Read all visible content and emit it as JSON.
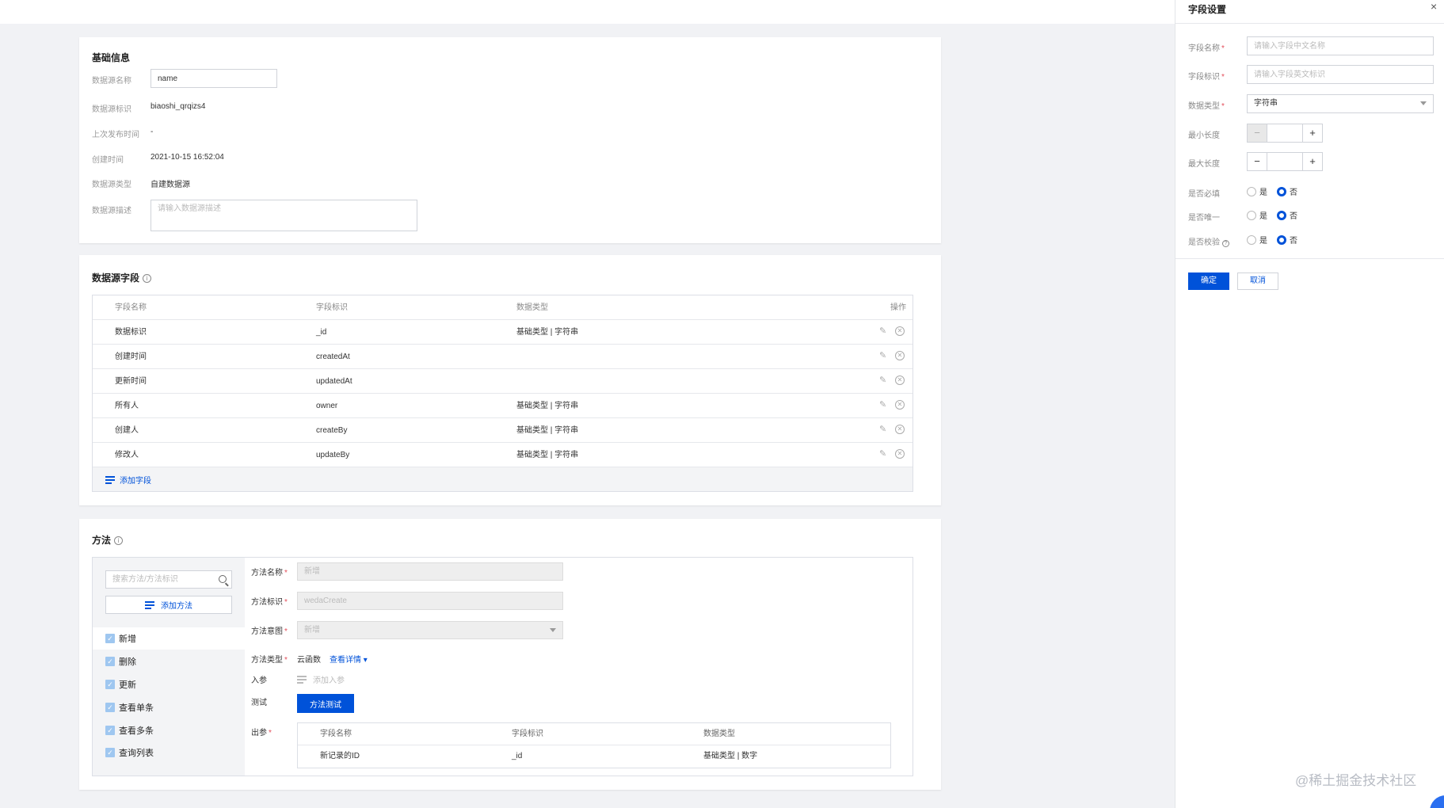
{
  "basic": {
    "title": "基础信息",
    "fields": [
      {
        "label": "数据源名称",
        "value": "name"
      },
      {
        "label": "数据源标识",
        "value": "biaoshi_qrqizs4"
      },
      {
        "label": "上次发布时间",
        "value": "-"
      },
      {
        "label": "创建时间",
        "value": "2021-10-15 16:52:04"
      },
      {
        "label": "数据源类型",
        "value": "自建数据源"
      },
      {
        "label": "数据源描述",
        "placeholder": "请输入数据源描述"
      }
    ]
  },
  "fields_section": {
    "title": "数据源字段",
    "columns": [
      "字段名称",
      "字段标识",
      "数据类型",
      "操作"
    ],
    "rows": [
      {
        "name": "数据标识",
        "key": "_id",
        "type": "基础类型 | 字符串"
      },
      {
        "name": "创建时间",
        "key": "createdAt",
        "type": ""
      },
      {
        "name": "更新时间",
        "key": "updatedAt",
        "type": ""
      },
      {
        "name": "所有人",
        "key": "owner",
        "type": "基础类型 | 字符串"
      },
      {
        "name": "创建人",
        "key": "createBy",
        "type": "基础类型 | 字符串"
      },
      {
        "name": "修改人",
        "key": "updateBy",
        "type": "基础类型 | 字符串"
      }
    ],
    "add_label": "添加字段"
  },
  "methods": {
    "title": "方法",
    "search_placeholder": "搜索方法/方法标识",
    "add_label": "添加方法",
    "items": [
      "新增",
      "删除",
      "更新",
      "查看单条",
      "查看多条",
      "查询列表"
    ],
    "detail": {
      "name_label": "方法名称",
      "name_value": "新增",
      "key_label": "方法标识",
      "key_value": "wedaCreate",
      "scope_label": "方法意图",
      "scope_value": "新增",
      "type_label": "方法类型",
      "type_value": "云函数",
      "type_link": "查看详情",
      "input_label": "入参",
      "input_add": "添加入参",
      "test_label": "测试",
      "test_button": "方法测试",
      "output_label": "出参",
      "output_columns": [
        "字段名称",
        "字段标识",
        "数据类型"
      ],
      "output_rows": [
        {
          "name": "新记录的ID",
          "key": "_id",
          "type": "基础类型 | 数字"
        }
      ]
    }
  },
  "drawer": {
    "title": "字段设置",
    "close": "×",
    "name_label": "字段名称",
    "name_placeholder": "请输入字段中文名称",
    "key_label": "字段标识",
    "key_placeholder": "请输入字段英文标识",
    "type_label": "数据类型",
    "type_value": "字符串",
    "min_label": "最小长度",
    "max_label": "最大长度",
    "required_label": "是否必填",
    "unique_label": "是否唯一",
    "validate_label": "是否校验",
    "yes": "是",
    "no": "否",
    "confirm": "确定",
    "cancel": "取消"
  },
  "watermark": "@稀土掘金技术社区",
  "colors": {
    "primary": "#0052d9",
    "required": "#e34d59"
  }
}
